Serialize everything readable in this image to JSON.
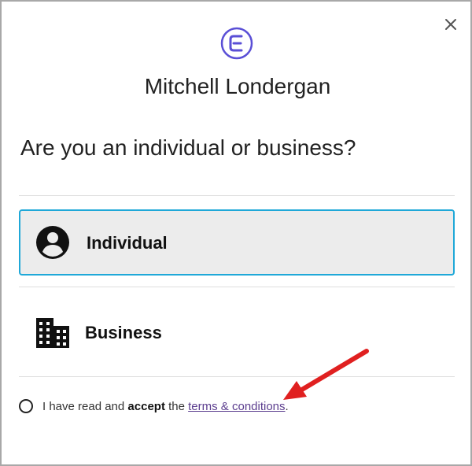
{
  "dialog": {
    "close_icon": "close-icon",
    "logo_icon": "brand-logo-icon",
    "account_name": "Mitchell Londergan",
    "question": "Are you an individual or business?"
  },
  "options": [
    {
      "icon": "person-circle-icon",
      "label": "Individual",
      "selected": true
    },
    {
      "icon": "building-icon",
      "label": "Business",
      "selected": false
    }
  ],
  "accept": {
    "prefix": "I have read and ",
    "bold": "accept",
    "middle": " the ",
    "link": "terms & conditions",
    "suffix": "."
  },
  "colors": {
    "selected_border": "#1fa8d8",
    "selected_bg": "#ececec",
    "logo": "#5a4fd6",
    "link": "#5b3d8e",
    "arrow": "#e02020"
  }
}
